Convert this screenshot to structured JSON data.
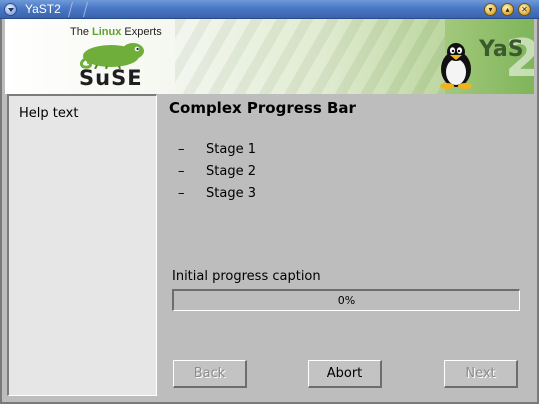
{
  "window": {
    "title": "YaST2",
    "controls": [
      "menu-icon",
      "minimize-icon",
      "maximize-icon",
      "close-icon"
    ]
  },
  "banner": {
    "tagline_prefix": "The ",
    "tagline_accent": "Linux",
    "tagline_suffix": " Experts",
    "brand": "SuSE",
    "product": "YaS",
    "product_digit": "2",
    "icons": [
      "chameleon-logo-icon",
      "penguin-icon"
    ]
  },
  "help": {
    "text": "Help text"
  },
  "main": {
    "title": "Complex Progress Bar",
    "stages": [
      {
        "bullet": "–",
        "label": "Stage 1"
      },
      {
        "bullet": "–",
        "label": "Stage 2"
      },
      {
        "bullet": "–",
        "label": "Stage 3"
      }
    ],
    "progress": {
      "caption": "Initial progress caption",
      "value_percent": 0,
      "label": "0%"
    }
  },
  "buttons": {
    "back": {
      "label": "Back",
      "enabled": false
    },
    "abort": {
      "label": "Abort",
      "enabled": true
    },
    "next": {
      "label": "Next",
      "enabled": false
    }
  },
  "colors": {
    "titlebar": "#4a78c4",
    "background": "#bdbdbd",
    "help_pane": "#e6e6e6",
    "brand_green": "#5ea32c"
  }
}
